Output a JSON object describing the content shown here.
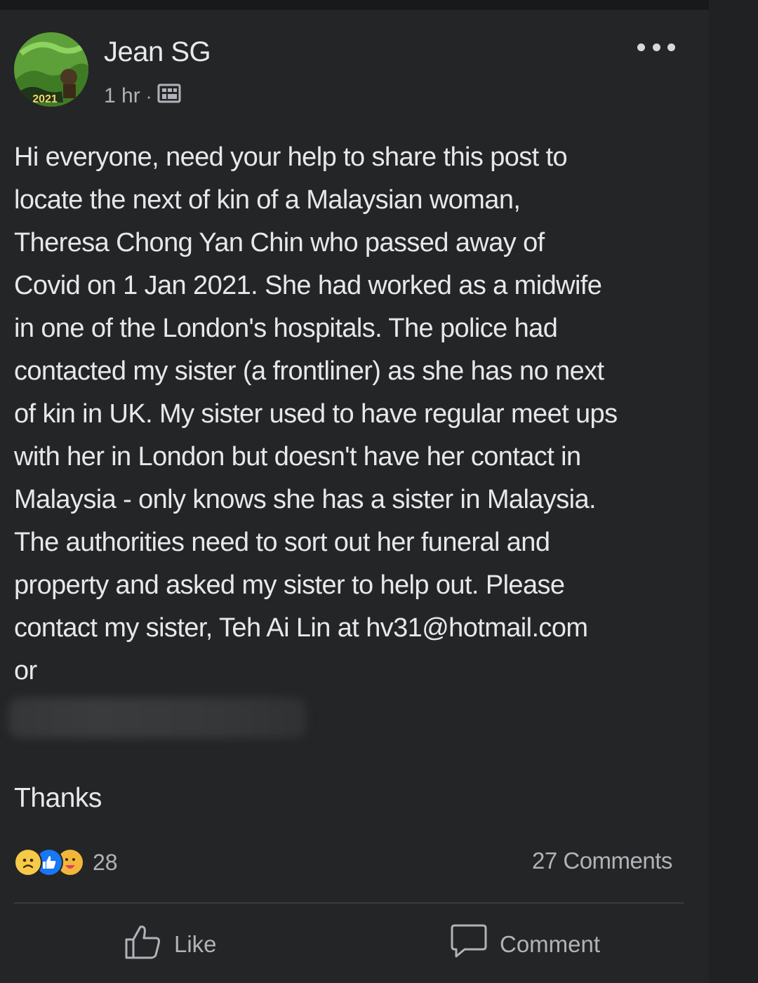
{
  "post": {
    "author_name": "Jean SG",
    "avatar_badge_text": "2021",
    "timestamp": "1 hr",
    "separator": "·",
    "privacy_icon": "group-icon",
    "body_lines": [
      "Hi everyone, need your help to share this post to",
      "locate the next of kin of a  Malaysian woman,",
      "Theresa Chong Yan Chin who passed away of",
      "Covid on 1 Jan 2021. She had worked as a midwife",
      "in one of the London's hospitals.  The police had",
      "contacted my sister (a frontliner) as she has no next",
      "of kin in UK. My sister used to have regular meet ups",
      "with her in London but doesn't have her contact in",
      "Malaysia - only knows she has a sister in Malaysia.",
      "The authorities need to sort out her funeral and",
      "property and asked my sister to help out.  Please",
      "contact my sister, Teh Ai Lin at hv31@hotmail.com",
      "or"
    ],
    "thanks": "Thanks"
  },
  "reactions": {
    "icons": [
      "sad-reaction-icon",
      "like-reaction-icon",
      "care-reaction-icon"
    ],
    "count": "28"
  },
  "comments_count": "27 Comments",
  "actions": {
    "like_label": "Like",
    "comment_label": "Comment"
  },
  "colors": {
    "background": "#242527",
    "text": "#e7e8eb",
    "secondary_text": "#b0b3b8",
    "like_blue": "#1877f2"
  }
}
